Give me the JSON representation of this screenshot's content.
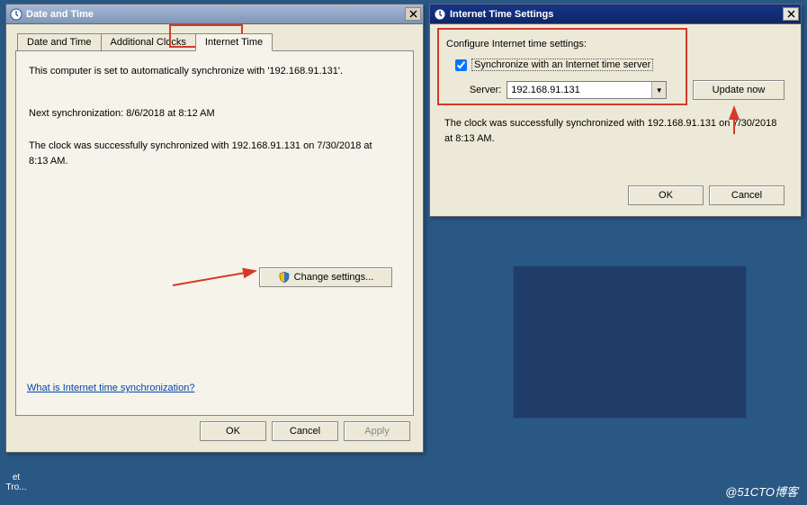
{
  "window1": {
    "title": "Date and Time",
    "tabs": [
      "Date and Time",
      "Additional Clocks",
      "Internet Time"
    ],
    "active_tab_index": 2,
    "sync_text": "This computer is set to automatically synchronize with '192.168.91.131'.",
    "next_sync": "Next synchronization: 8/6/2018 at 8:12 AM",
    "status": "The clock was successfully synchronized with 192.168.91.131 on 7/30/2018 at 8:13 AM.",
    "change_settings": "Change settings...",
    "help_link": "What is Internet time synchronization?",
    "buttons": {
      "ok": "OK",
      "cancel": "Cancel",
      "apply": "Apply"
    }
  },
  "window2": {
    "title": "Internet Time Settings",
    "group_legend": "Configure Internet time settings:",
    "checkbox_label": "Synchronize with an Internet time server",
    "checkbox_checked": true,
    "server_label": "Server:",
    "server_value": "192.168.91.131",
    "update_now": "Update now",
    "status": "The clock was successfully synchronized with 192.168.91.131 on 7/30/2018 at 8:13 AM.",
    "buttons": {
      "ok": "OK",
      "cancel": "Cancel"
    }
  },
  "desktop": {
    "icon1_line1": "et",
    "icon1_line2": "Tro...",
    "watermark": "@51CTO博客"
  },
  "colors": {
    "annotation": "#d43a2a"
  }
}
